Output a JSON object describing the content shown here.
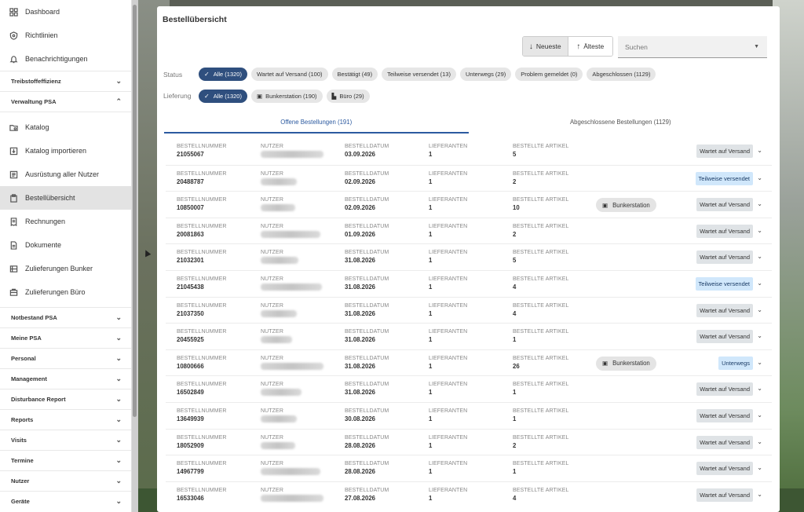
{
  "sidebar": {
    "top_items": [
      {
        "label": "Dashboard",
        "icon": "grid-icon"
      },
      {
        "label": "Richtlinien",
        "icon": "shield-icon"
      },
      {
        "label": "Benachrichtigungen",
        "icon": "bell-icon"
      }
    ],
    "groups_top": [
      {
        "label": "Treibstoffeffizienz",
        "chev": "⌄"
      },
      {
        "label": "Verwaltung PSA",
        "chev": "⌃"
      }
    ],
    "psa_items": [
      {
        "label": "Katalog",
        "icon": "folder-search-icon"
      },
      {
        "label": "Katalog importieren",
        "icon": "import-icon"
      },
      {
        "label": "Ausrüstung aller Nutzer",
        "icon": "list-icon"
      },
      {
        "label": "Bestellübersicht",
        "icon": "clipboard-icon",
        "active": true
      },
      {
        "label": "Rechnungen",
        "icon": "receipt-icon"
      },
      {
        "label": "Dokumente",
        "icon": "document-icon"
      },
      {
        "label": "Zulieferungen Bunker",
        "icon": "bunker-icon"
      },
      {
        "label": "Zulieferungen Büro",
        "icon": "office-icon"
      }
    ],
    "groups_bottom": [
      {
        "label": "Notbestand PSA",
        "chev": "⌄"
      },
      {
        "label": "Meine PSA",
        "chev": "⌄"
      },
      {
        "label": "Personal",
        "chev": "⌄"
      },
      {
        "label": "Management",
        "chev": "⌄"
      },
      {
        "label": "Disturbance Report",
        "chev": "⌄"
      },
      {
        "label": "Reports",
        "chev": "⌄"
      },
      {
        "label": "Visits",
        "chev": "⌄"
      },
      {
        "label": "Termine",
        "chev": "⌄"
      },
      {
        "label": "Nutzer",
        "chev": "⌄"
      },
      {
        "label": "Geräte",
        "chev": "⌄"
      }
    ]
  },
  "page": {
    "title": "Bestellübersicht",
    "sort_newest": "Neueste",
    "sort_oldest": "Älteste",
    "search_placeholder": "Suchen",
    "status_label": "Status",
    "delivery_label": "Lieferung",
    "status_chips": [
      "Alle (1320)",
      "Wartet auf Versand (100)",
      "Bestätigt (49)",
      "Teilweise versendet (13)",
      "Unterwegs (29)",
      "Problem gemeldet (0)",
      "Abgeschlossen (1129)"
    ],
    "delivery_chips": [
      "Alle (1320)",
      "Bunkerstation (190)",
      "Büro (29)"
    ],
    "tabs": [
      "Offene Bestellungen (191)",
      "Abgeschlossene Bestellungen (1129)"
    ],
    "labels": {
      "order": "BESTELLNUMMER",
      "user": "NUTZER",
      "date": "BESTELLDATUM",
      "suppliers": "LIEFERANTEN",
      "articles": "BESTELLTE ARTIKEL"
    }
  },
  "orders": [
    {
      "nr": "21055067",
      "date": "03.09.2026",
      "suppliers": "1",
      "articles": "5",
      "loc": "",
      "status": "Wartet auf Versand",
      "blue": false
    },
    {
      "nr": "20488787",
      "date": "02.09.2026",
      "suppliers": "1",
      "articles": "2",
      "loc": "",
      "status": "Teilweise versendet",
      "blue": true
    },
    {
      "nr": "10850007",
      "date": "02.09.2026",
      "suppliers": "1",
      "articles": "10",
      "loc": "Bunkerstation",
      "status": "Wartet auf Versand",
      "blue": false
    },
    {
      "nr": "20081863",
      "date": "01.09.2026",
      "suppliers": "1",
      "articles": "2",
      "loc": "",
      "status": "Wartet auf Versand",
      "blue": false
    },
    {
      "nr": "21032301",
      "date": "31.08.2026",
      "suppliers": "1",
      "articles": "5",
      "loc": "",
      "status": "Wartet auf Versand",
      "blue": false
    },
    {
      "nr": "21045438",
      "date": "31.08.2026",
      "suppliers": "1",
      "articles": "4",
      "loc": "",
      "status": "Teilweise versendet",
      "blue": true
    },
    {
      "nr": "21037350",
      "date": "31.08.2026",
      "suppliers": "1",
      "articles": "4",
      "loc": "",
      "status": "Wartet auf Versand",
      "blue": false
    },
    {
      "nr": "20455925",
      "date": "31.08.2026",
      "suppliers": "1",
      "articles": "1",
      "loc": "",
      "status": "Wartet auf Versand",
      "blue": false
    },
    {
      "nr": "10800666",
      "date": "31.08.2026",
      "suppliers": "1",
      "articles": "26",
      "loc": "Bunkerstation",
      "status": "Unterwegs",
      "blue": true
    },
    {
      "nr": "16502849",
      "date": "31.08.2026",
      "suppliers": "1",
      "articles": "1",
      "loc": "",
      "status": "Wartet auf Versand",
      "blue": false
    },
    {
      "nr": "13649939",
      "date": "30.08.2026",
      "suppliers": "1",
      "articles": "1",
      "loc": "",
      "status": "Wartet auf Versand",
      "blue": false
    },
    {
      "nr": "18052909",
      "date": "28.08.2026",
      "suppliers": "1",
      "articles": "2",
      "loc": "",
      "status": "Wartet auf Versand",
      "blue": false
    },
    {
      "nr": "14967799",
      "date": "28.08.2026",
      "suppliers": "1",
      "articles": "1",
      "loc": "",
      "status": "Wartet auf Versand",
      "blue": false
    },
    {
      "nr": "16533046",
      "date": "27.08.2026",
      "suppliers": "1",
      "articles": "4",
      "loc": "",
      "status": "Wartet auf Versand",
      "blue": false
    }
  ]
}
